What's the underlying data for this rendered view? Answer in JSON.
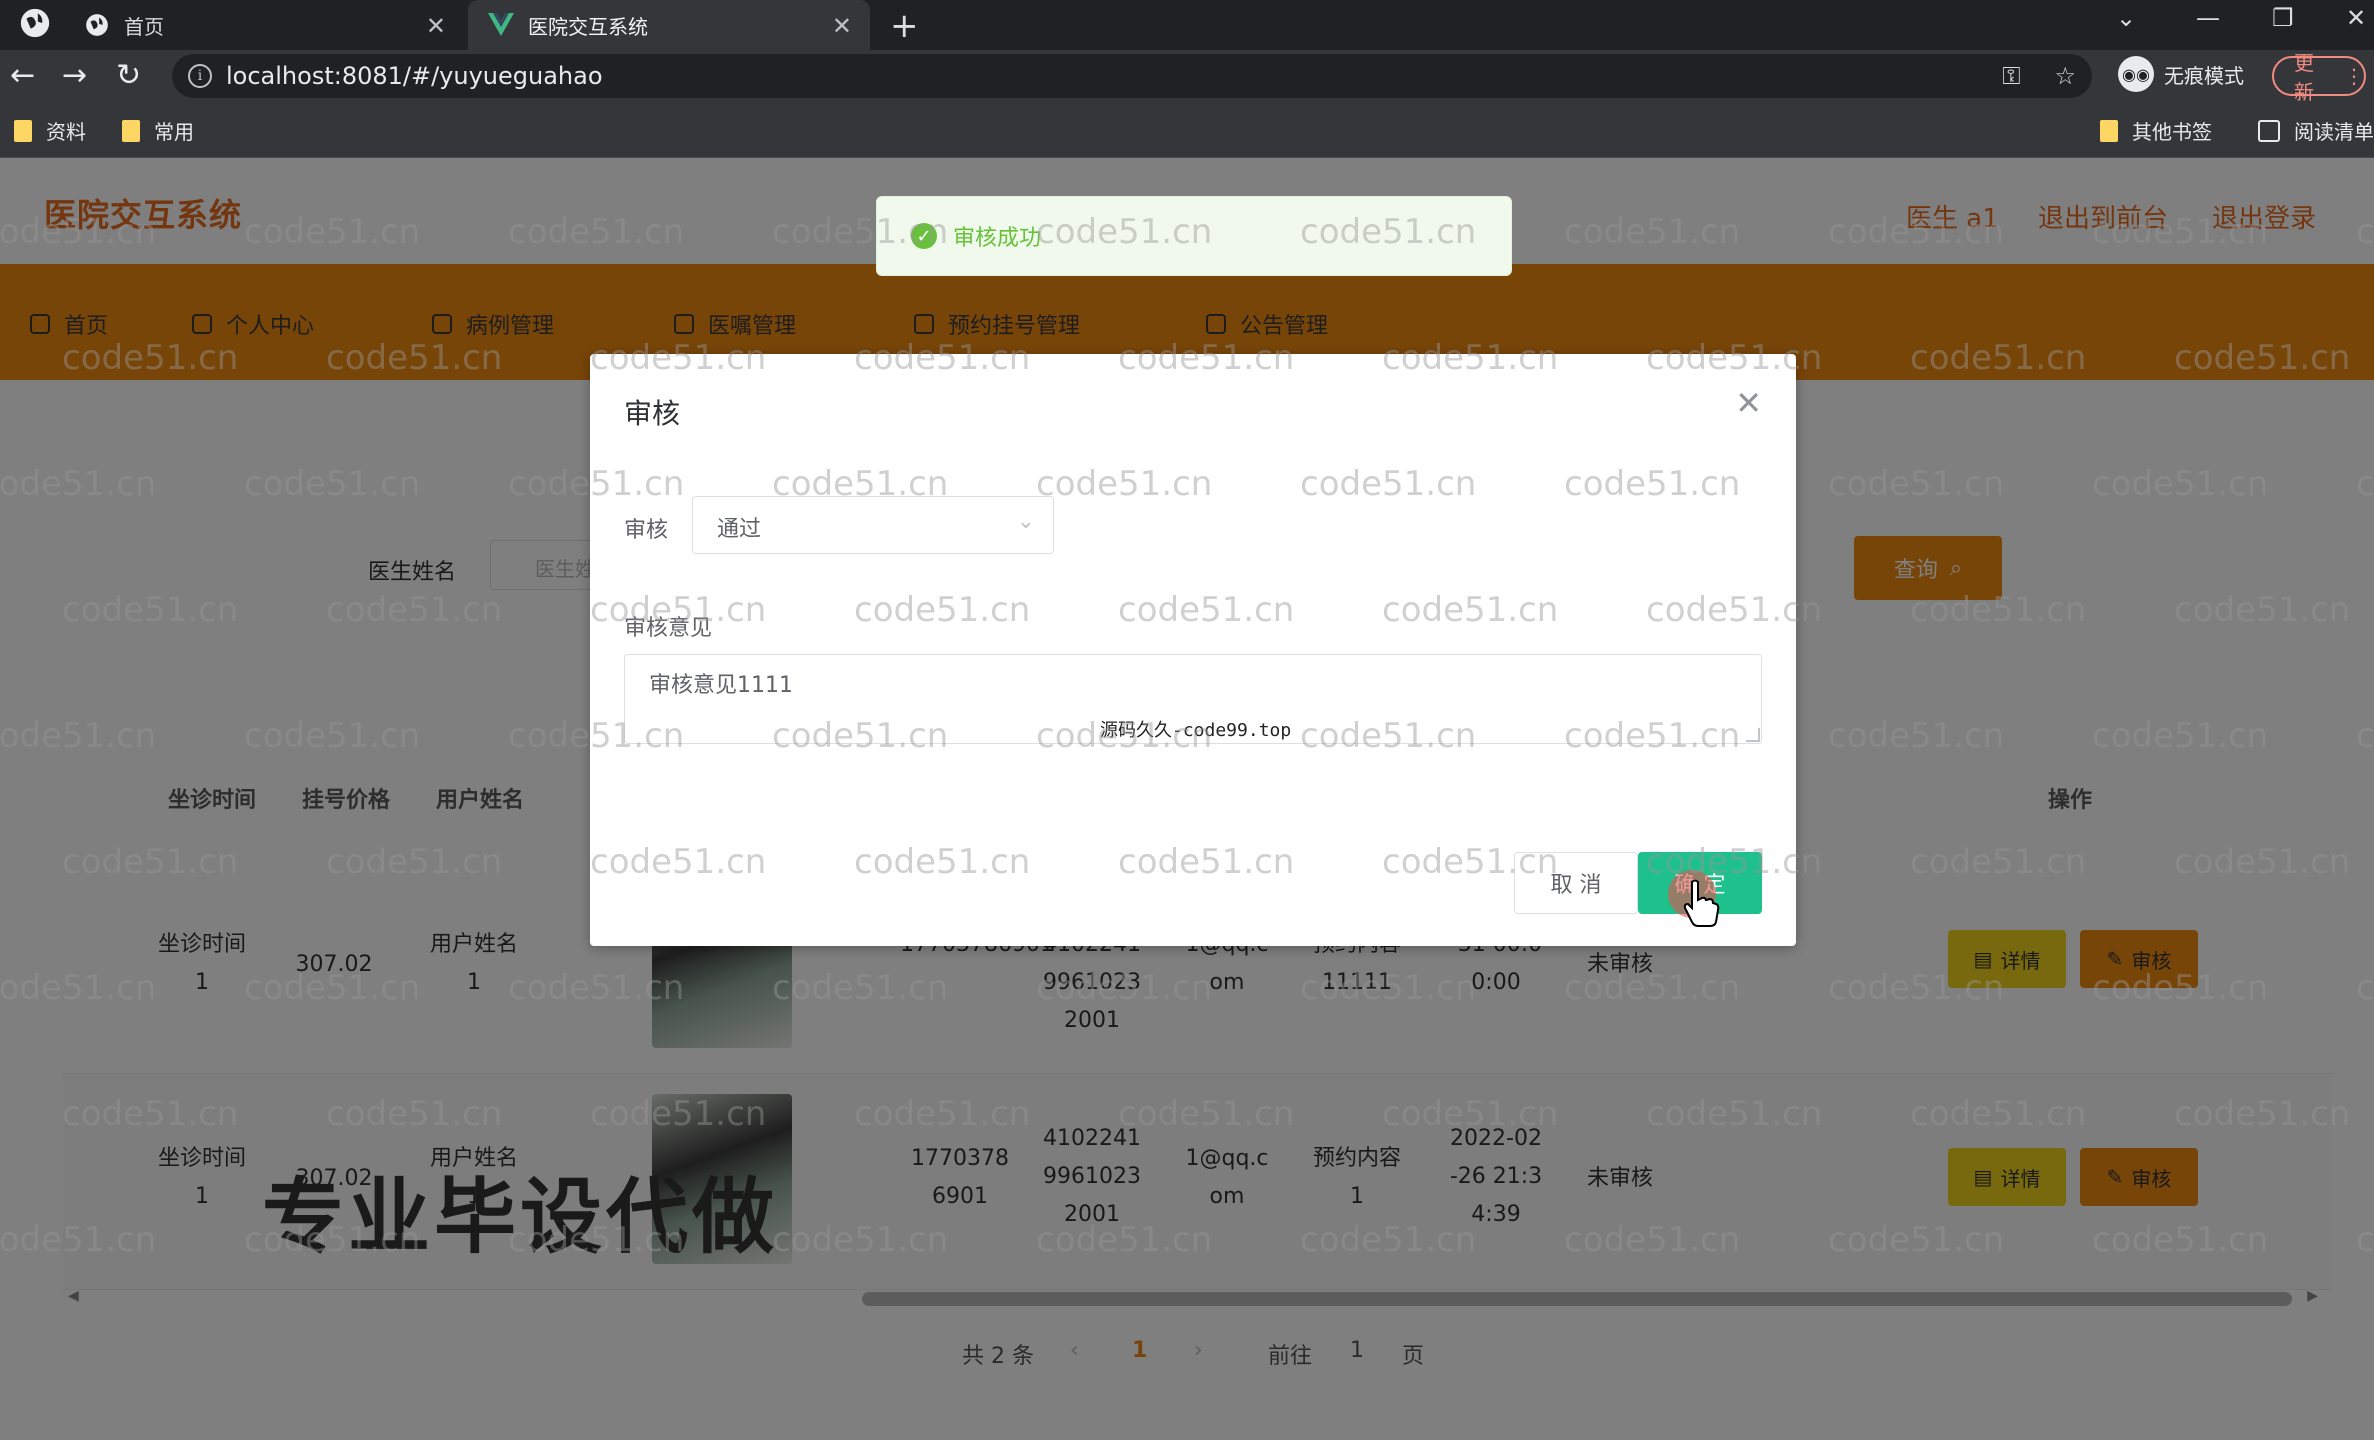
{
  "browser": {
    "tabs": [
      {
        "label": "首页",
        "icon": "globe-icon"
      },
      {
        "label": "医院交互系统",
        "icon": "vue-logo-icon"
      }
    ],
    "url": "localhost:8081/#/yuyueguahao",
    "incognito_label": "无痕模式",
    "update_label": "更新",
    "bookmarks": [
      "资料",
      "常用"
    ],
    "other_bookmarks": "其他书签",
    "reading_list": "阅读清单"
  },
  "app": {
    "logo": "医院交互系统",
    "header_links": [
      "医生 a1",
      "退出到前台",
      "退出登录"
    ],
    "menu": [
      "首页",
      "个人中心",
      "病例管理",
      "医嘱管理",
      "预约挂号管理",
      "公告管理"
    ],
    "search": {
      "label": "医生姓名",
      "placeholder": "医生姓名",
      "button": "查询"
    },
    "columns": [
      "坐诊时间",
      "挂号价格",
      "用户姓名",
      "操作"
    ],
    "rows": [
      {
        "zuozhen": "坐诊时间\n1",
        "price": "307.02",
        "user": "用户姓名\n1",
        "phone": "17703786901",
        "id_card": "4102241\n9961023\n2001",
        "email": "1@qq.c\nom",
        "content": "预约内容\n11111",
        "time": "-31 00:0\n0:00",
        "status": "未审核"
      },
      {
        "zuozhen": "坐诊时间\n1",
        "price": "307.02",
        "user": "用户姓名\n1",
        "phone": "1770378\n6901",
        "id_card": "4102241\n9961023\n2001",
        "email": "1@qq.c\nom",
        "content": "预约内容\n1",
        "time": "2022-02\n-26 21:3\n4:39",
        "status": "未审核"
      }
    ],
    "row_actions": {
      "detail": "详情",
      "audit": "审核"
    },
    "pager": {
      "total": "共 2 条",
      "current": "1",
      "goto": "前往",
      "page_num": "1",
      "page": "页"
    },
    "promo": "专业毕设代做"
  },
  "toast": {
    "message": "审核成功"
  },
  "dialog": {
    "title": "审核",
    "field_audit_label": "审核",
    "field_audit_value": "通过",
    "field_opinion_label": "审核意见",
    "field_opinion_value": "审核意见1111",
    "cancel": "取 消",
    "confirm": "确 定",
    "watermark_text": "源码久久-code99.top"
  },
  "watermark": "code51.cn",
  "colors": {
    "brand": "#f08a13",
    "success": "#67c23a",
    "confirm": "#1ec08b",
    "detail": "#f2d21c"
  }
}
